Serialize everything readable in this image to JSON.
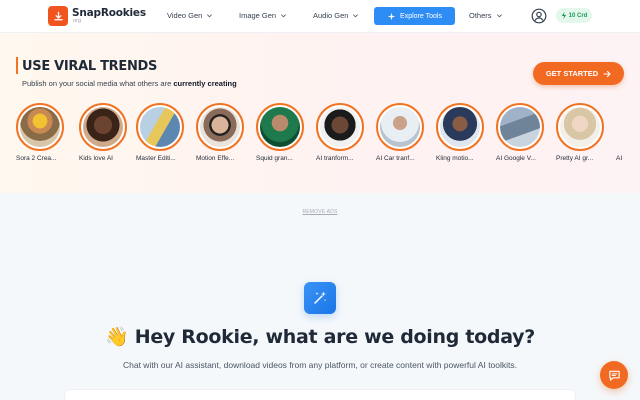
{
  "header": {
    "brand_title": "SnapRookies",
    "brand_sub": "org",
    "nav": [
      "Video Gen",
      "Image Gen",
      "Audio Gen"
    ],
    "explore_label": "Explore Tools",
    "others_label": "Others",
    "credits_label": "10 Crd"
  },
  "trends": {
    "title": "USE VIRAL TRENDS",
    "subtitle_prefix": "Publish on your social media what others are ",
    "subtitle_bold": "currently creating",
    "cta_label": "GET STARTED",
    "items": [
      {
        "label": "Sora 2 Crea..."
      },
      {
        "label": "Kids love AI"
      },
      {
        "label": "Master Editi..."
      },
      {
        "label": "Motion Effe..."
      },
      {
        "label": "Squid gran..."
      },
      {
        "label": "AI tranform..."
      },
      {
        "label": "AI Car tranf..."
      },
      {
        "label": "Kling motio..."
      },
      {
        "label": "AI Google V..."
      },
      {
        "label": "Pretty AI gr..."
      },
      {
        "label": "AI"
      }
    ]
  },
  "ads": {
    "remove_label": "REMOVE ADS"
  },
  "hero": {
    "title": "👋 Hey Rookie, what are we doing today?",
    "subtitle": "Chat with our AI assistant, download videos from any platform, or create content with powerful AI toolkits."
  },
  "colors": {
    "accent_orange": "#f26a21",
    "accent_blue": "#2e8df5",
    "credit_green": "#1c9a55"
  },
  "icons": {
    "logo": "download-icon",
    "explore": "sparkle-icon",
    "user": "user-circle-icon",
    "credits": "bolt-icon",
    "cta": "arrow-right-icon",
    "hero": "magic-wand-icon",
    "fab": "chat-icon"
  }
}
